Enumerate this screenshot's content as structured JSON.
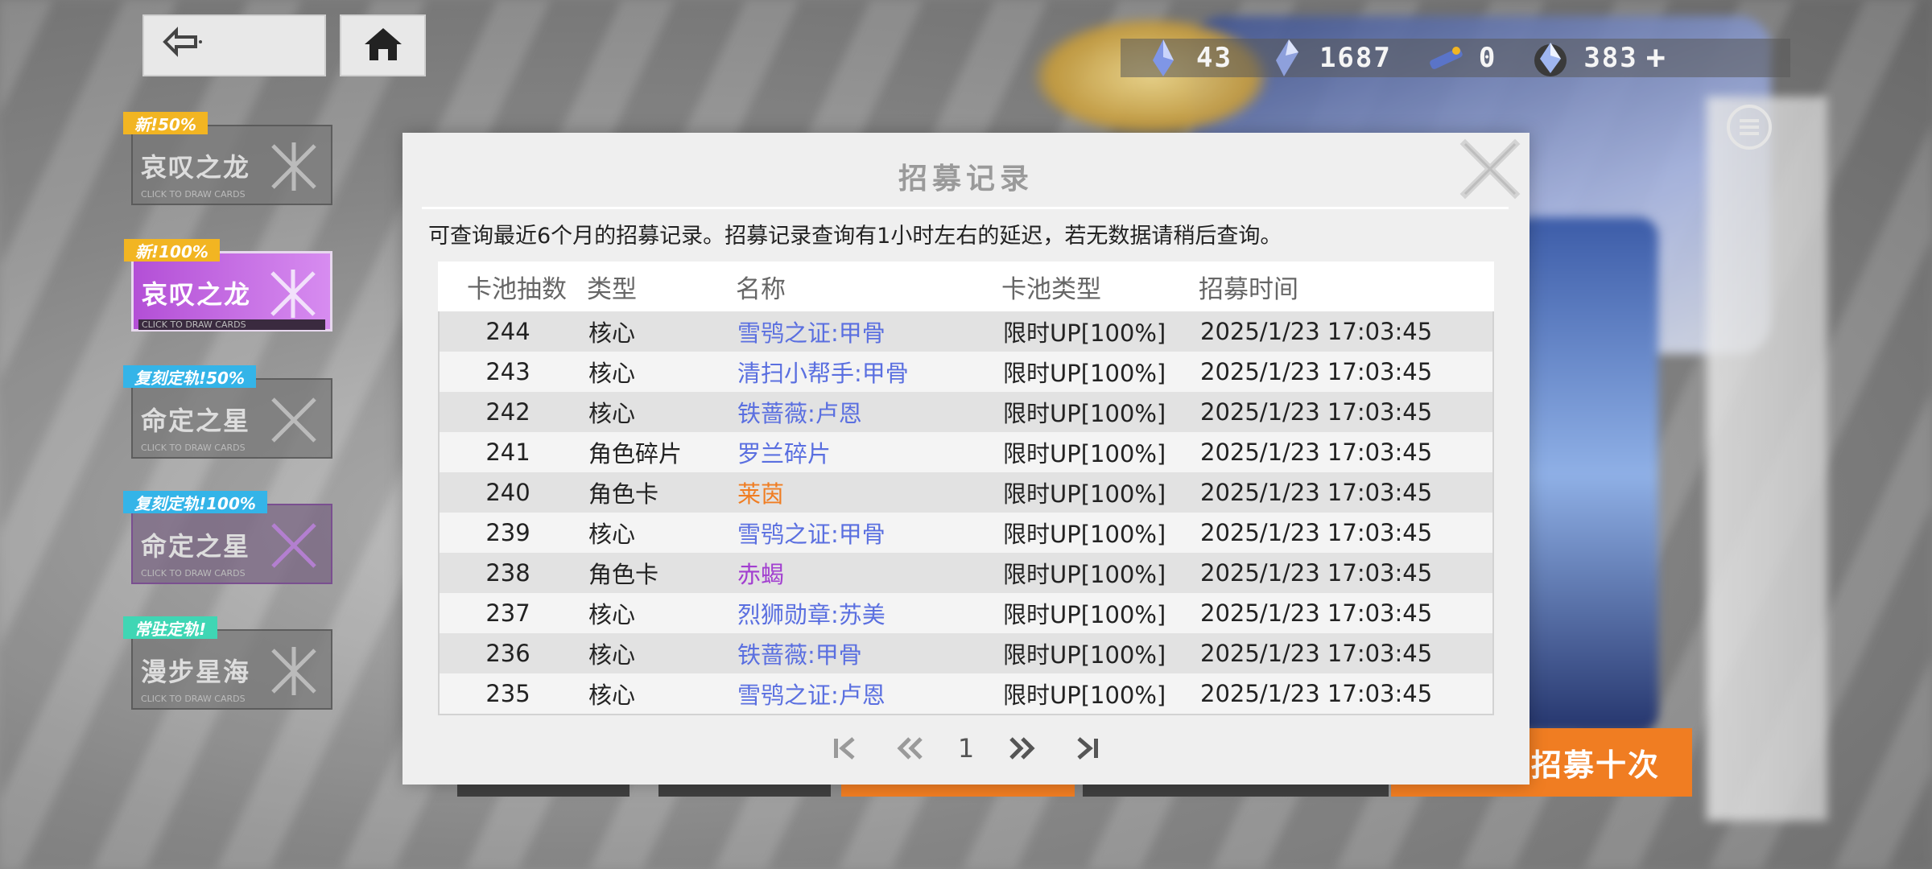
{
  "colors": {
    "accent_orange": "#f07d22",
    "item_blue": "#5a6fe0",
    "item_orange": "#f07d22",
    "item_purple": "#a23fd0",
    "banner_active": "#c06ae0",
    "tag_yellow": "#f2b522",
    "tag_cyan": "#34b4e8",
    "tag_teal": "#3fd6b4"
  },
  "topbar": {
    "back_icon": "back-arrow-icon",
    "home_icon": "home-icon",
    "currencies": [
      {
        "icon": "crystal-icon",
        "value": "43"
      },
      {
        "icon": "shard-icon",
        "value": "1687"
      },
      {
        "icon": "ticket-icon",
        "value": "0"
      },
      {
        "icon": "gem-icon",
        "value": "383"
      }
    ],
    "add_label": "+"
  },
  "banners": [
    {
      "tag": "新!50%",
      "name": "哀叹之龙",
      "sub": "CLICK TO DRAW CARDS",
      "active": false
    },
    {
      "tag": "新!100%",
      "name": "哀叹之龙",
      "sub": "CLICK TO DRAW CARDS",
      "active": true
    },
    {
      "tag": "复刻定轨!50%",
      "name": "命定之星",
      "sub": "CLICK TO DRAW CARDS",
      "active": false
    },
    {
      "tag": "复刻定轨!100%",
      "name": "命定之星",
      "sub": "CLICK TO DRAW CARDS",
      "active": false
    },
    {
      "tag": "常驻定轨!",
      "name": "漫步星海",
      "sub": "CLICK TO DRAW CARDS",
      "active": false
    }
  ],
  "draw_ten_label": "招募十次",
  "modal": {
    "title": "招募记录",
    "notice": "可查询最近6个月的招募记录。招募记录查询有1小时左右的延迟，若无数据请稍后查询。",
    "columns": [
      "卡池抽数",
      "类型",
      "名称",
      "卡池类型",
      "招募时间"
    ],
    "rows": [
      {
        "num": "244",
        "type": "核心",
        "name": "雪鸮之证:甲骨",
        "color": "blue",
        "pool": "限时UP[100%]",
        "time": "2025/1/23 17:03:45"
      },
      {
        "num": "243",
        "type": "核心",
        "name": "清扫小帮手:甲骨",
        "color": "blue",
        "pool": "限时UP[100%]",
        "time": "2025/1/23 17:03:45"
      },
      {
        "num": "242",
        "type": "核心",
        "name": "铁蔷薇:卢恩",
        "color": "blue",
        "pool": "限时UP[100%]",
        "time": "2025/1/23 17:03:45"
      },
      {
        "num": "241",
        "type": "角色碎片",
        "name": "罗兰碎片",
        "color": "blue",
        "pool": "限时UP[100%]",
        "time": "2025/1/23 17:03:45"
      },
      {
        "num": "240",
        "type": "角色卡",
        "name": "莱茵",
        "color": "orange",
        "pool": "限时UP[100%]",
        "time": "2025/1/23 17:03:45"
      },
      {
        "num": "239",
        "type": "核心",
        "name": "雪鸮之证:甲骨",
        "color": "blue",
        "pool": "限时UP[100%]",
        "time": "2025/1/23 17:03:45"
      },
      {
        "num": "238",
        "type": "角色卡",
        "name": "赤蝎",
        "color": "purple",
        "pool": "限时UP[100%]",
        "time": "2025/1/23 17:03:45"
      },
      {
        "num": "237",
        "type": "核心",
        "name": "烈狮勋章:苏美",
        "color": "blue",
        "pool": "限时UP[100%]",
        "time": "2025/1/23 17:03:45"
      },
      {
        "num": "236",
        "type": "核心",
        "name": "铁蔷薇:甲骨",
        "color": "blue",
        "pool": "限时UP[100%]",
        "time": "2025/1/23 17:03:45"
      },
      {
        "num": "235",
        "type": "核心",
        "name": "雪鸮之证:卢恩",
        "color": "blue",
        "pool": "限时UP[100%]",
        "time": "2025/1/23 17:03:45"
      }
    ],
    "pager": {
      "page": "1",
      "icons": [
        "first-page-icon",
        "prev-page-icon",
        "next-page-icon",
        "last-page-icon"
      ]
    }
  }
}
